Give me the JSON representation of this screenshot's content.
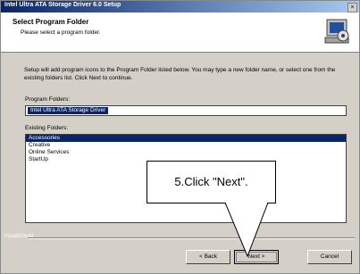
{
  "window": {
    "title": "Intel Ultra ATA Storage Driver 6.0 Setup",
    "close": "×"
  },
  "header": {
    "title": "Select Program Folder",
    "subtitle": "Please select a program folder."
  },
  "body": {
    "description": "Setup will add program icons to the Program Folder listed below. You may type a new folder name, or select one from the existing folders list. Click Next to continue.",
    "program_folder_label": "Program Folders:",
    "program_folder_value": "Intel Ultra ATA Storage Driver",
    "existing_folders_label": "Existing Folders:",
    "existing_folders": [
      "Accessories",
      "Creative",
      "Online Services",
      "StartUp"
    ],
    "selected_index": 0
  },
  "footer": {
    "brand": "InstallShield",
    "back_label": "< Back",
    "next_label": "Next >",
    "cancel_label": "Cancel"
  },
  "callout": {
    "text": "5.Click \"Next\"."
  }
}
